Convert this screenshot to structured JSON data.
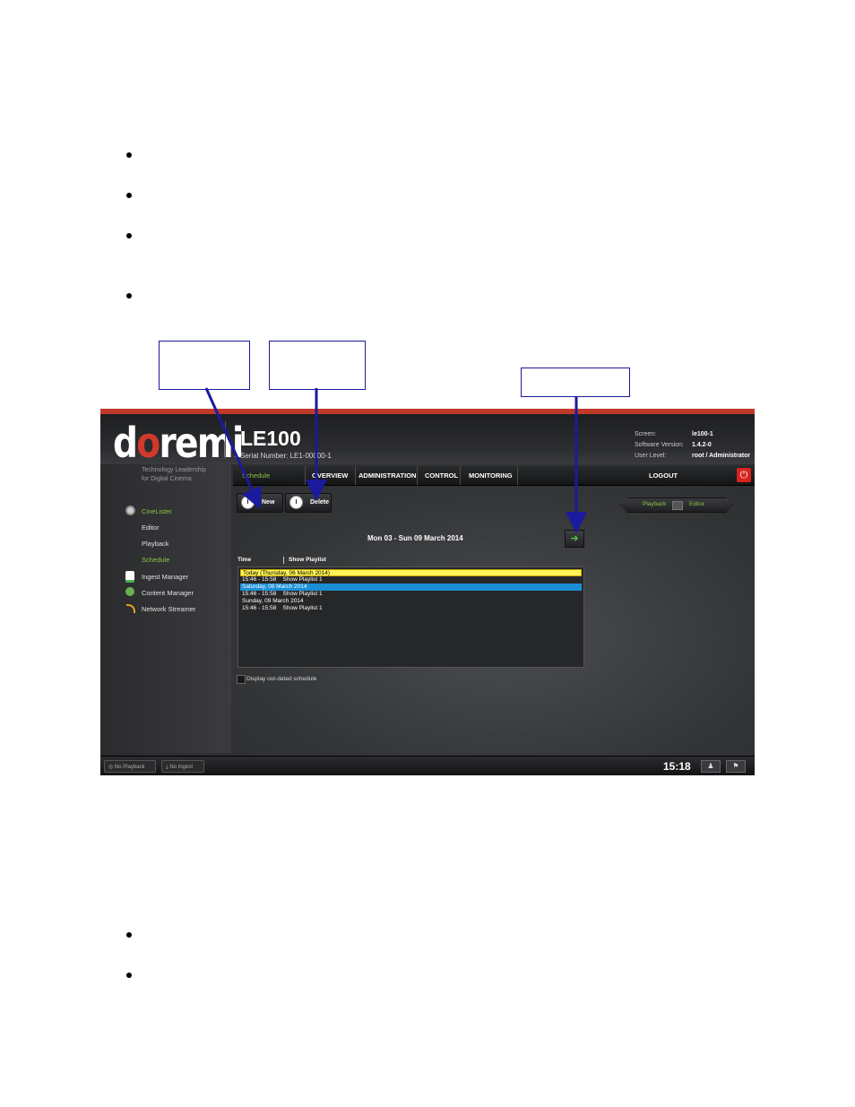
{
  "document": {
    "bullets_top": [
      "",
      "",
      "",
      ""
    ],
    "bullets_bottom": [
      "",
      ""
    ]
  },
  "header": {
    "logo_prefix": "d",
    "logo_o": "o",
    "logo_suffix": "remi",
    "model": "LE100",
    "serial": "Serial Number: LE1-00000-1",
    "tagline_line1": "Technology Leadership",
    "tagline_line2": "for Digital Cinema",
    "info_labels": [
      "Screen:",
      "Software Version:",
      "User Level:"
    ],
    "info_values": [
      "le100-1",
      "1.4.2-0",
      "root / Administrator"
    ]
  },
  "nav": {
    "items": [
      "Schedule",
      "OVERVIEW",
      "ADMINISTRATION",
      "CONTROL",
      "MONITORING"
    ],
    "logout": "LOGOUT",
    "power_icon": "power-icon"
  },
  "sidebar": {
    "cinelister": "CineLister",
    "editor": "Editor",
    "playback": "Playback",
    "schedule": "Schedule",
    "ingest": "Ingest Manager",
    "content": "Content Manager",
    "streamer": "Network Streamer"
  },
  "toolbar": {
    "new_label": "New",
    "delete_label": "Delete",
    "toggle_playback": "Playback",
    "toggle_editor": "Editor"
  },
  "schedule": {
    "week_label": "Mon 03 - Sun 09 March 2014",
    "col_time": "Time",
    "col_playlist": "Show Playlist",
    "rows": [
      "Today (Thursday, 06 March 2014)",
      "15:46 - 15:58    Show Playlist 1",
      "Saturday, 08 March 2014",
      "15:46 - 15:58    Show Playlist 1",
      "Sunday, 09 March 2014",
      "15:46 - 15:58    Show Playlist 1"
    ],
    "outdated_label": "Display out-dated schedule"
  },
  "status": {
    "playback": "No Playback",
    "ingest": "No Ingest",
    "time": "15:18"
  },
  "colors": {
    "accent_green": "#8cc63f",
    "today_yellow": "#fff55a",
    "selected_blue": "#1b8fd6",
    "callout_blue": "#1a1a9e",
    "power_red": "#d8231f"
  }
}
